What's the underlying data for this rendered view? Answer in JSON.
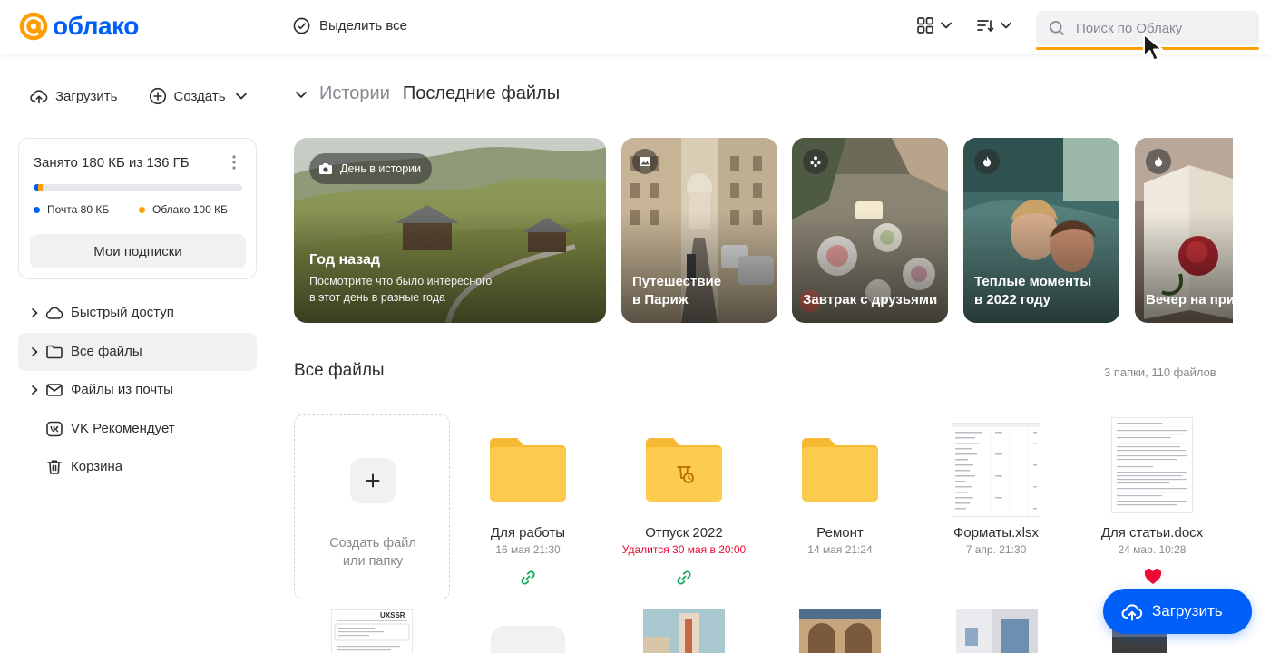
{
  "brand": {
    "name": "облако",
    "accent": "#005ff9",
    "logo_accent": "#ff9e00"
  },
  "header": {
    "select_all": "Выделить все",
    "search_placeholder": "Поиск по Облаку"
  },
  "sidebar": {
    "upload_label": "Загрузить",
    "create_label": "Создать",
    "storage": {
      "title": "Занято 180 КБ из 136 ГБ",
      "mail_label": "Почта 80 КБ",
      "cloud_label": "Облако 100 КБ",
      "mail_color": "#005ff9",
      "cloud_color": "#ff9e00",
      "subscriptions_label": "Мои подписки"
    },
    "nav": [
      {
        "label": "Быстрый доступ",
        "icon": "cloud-icon",
        "expandable": true,
        "active": false
      },
      {
        "label": "Все файлы",
        "icon": "folder-icon",
        "expandable": true,
        "active": true
      },
      {
        "label": "Файлы из почты",
        "icon": "mail-icon",
        "expandable": true,
        "active": false
      },
      {
        "label": "VK Рекомендует",
        "icon": "vk-icon",
        "expandable": false,
        "active": false
      },
      {
        "label": "Корзина",
        "icon": "trash-icon",
        "expandable": false,
        "active": false
      }
    ]
  },
  "stories": {
    "tab_stories": "Истории",
    "tab_recent": "Последние файлы",
    "items": [
      {
        "badge": "День в истории",
        "title": "Год назад",
        "subtitle_line1": "Посмотрите что было интересного",
        "subtitle_line2": "в этот день в разные года"
      },
      {
        "title_line1": "Путешествие",
        "title_line2": "в Париж",
        "icon": "photo-icon"
      },
      {
        "title_line1": "Завтрак с друзьями",
        "icon": "people-icon"
      },
      {
        "title_line1": "Теплые моменты",
        "title_line2": "в 2022 году",
        "icon": "flame-icon"
      },
      {
        "title_line1": "Вечер на природе",
        "icon": "flame-icon"
      }
    ]
  },
  "files": {
    "title": "Все файлы",
    "count": "3 папки, 110 файлов",
    "create_line1": "Создать файл",
    "create_line2": "или папку",
    "items": [
      {
        "name": "Для работы",
        "date": "16 мая 21:30",
        "type": "folder",
        "shared": true
      },
      {
        "name": "Отпуск 2022",
        "date": "Удалится 30 мая в 20:00",
        "type": "folder-timer",
        "shared": true,
        "expiring": true
      },
      {
        "name": "Ремонт",
        "date": "14 мая 21:24",
        "type": "folder"
      },
      {
        "name": "Форматы.xlsx",
        "date": "7 апр. 21:30",
        "type": "spreadsheet"
      },
      {
        "name": "Для статьи.docx",
        "date": "24 мар. 10:28",
        "type": "document",
        "favorite": true
      }
    ],
    "second_row_doc_heading": "UXSSR"
  },
  "fab": {
    "label": "Загрузить"
  }
}
